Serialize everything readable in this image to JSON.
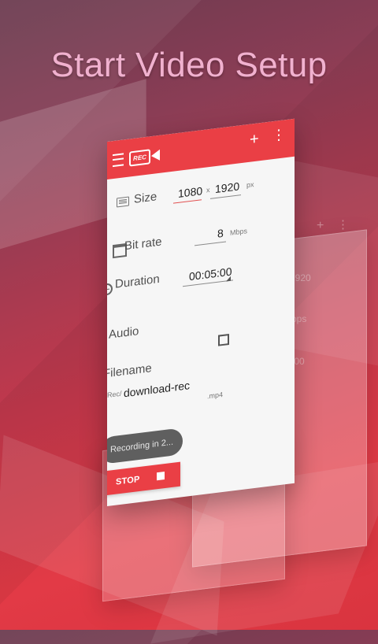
{
  "hero_title": "Start Video Setup",
  "toolbar": {
    "logo_text": "REC",
    "plus_symbol": "+",
    "more_symbol": "⋮"
  },
  "settings": {
    "size": {
      "label": "Size",
      "width": "1080",
      "separator": "x",
      "height": "1920",
      "unit": "px"
    },
    "bit_rate": {
      "label": "Bit rate",
      "value": "8",
      "unit": "Mbps"
    },
    "duration": {
      "label": "Duration",
      "value": "00:05:00"
    },
    "audio": {
      "label": "Audio",
      "checked": false
    },
    "filename": {
      "label": "Filename",
      "path": "/sdcard/Rec/",
      "name": "download-rec",
      "extension": ".mp4"
    }
  },
  "toast": "Recording in 2...",
  "stop_button": "STOP"
}
